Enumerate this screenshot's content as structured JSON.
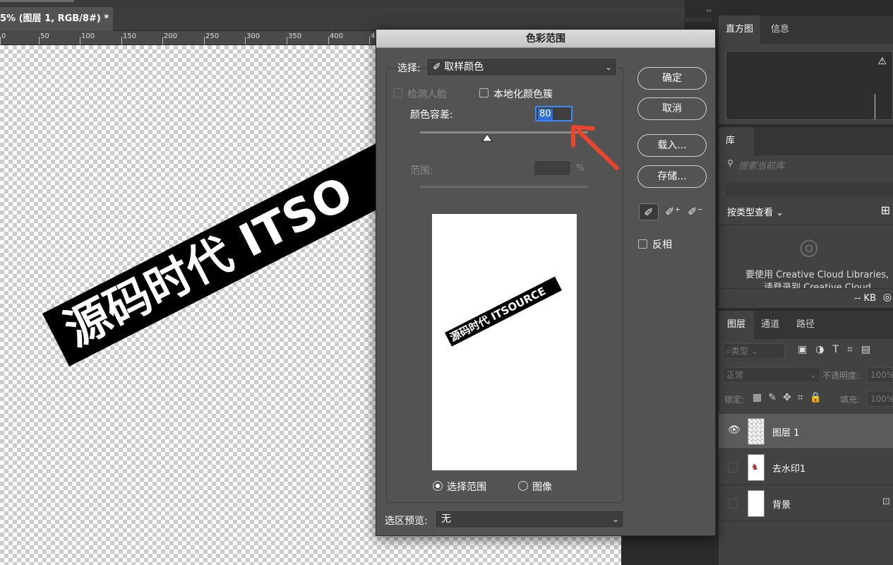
{
  "document": {
    "tab_title": "5% (图层 1, RGB/8#) *",
    "ruler_marks": [
      "0",
      "50",
      "100",
      "150",
      "200",
      "250",
      "300",
      "350",
      "400",
      "4"
    ],
    "canvas_text": "源码时代 ITSO"
  },
  "dialog": {
    "title": "色彩范围",
    "select_label": "选择:",
    "select_value": "取样颜色",
    "detect_faces_label": "检测人脸",
    "localized_clusters_label": "本地化颜色簇",
    "fuzziness_label": "颜色容差:",
    "fuzziness_value": "80",
    "fuzziness_level": 0.4,
    "range_label": "范围:",
    "range_unit": "%",
    "preview_text": "源码时代 ITSOURCE",
    "radio_selection_label": "选择范围",
    "radio_image_label": "图像",
    "selection_preview_label": "选区预览:",
    "selection_preview_value": "无",
    "buttons": {
      "ok": "确定",
      "cancel": "取消",
      "load": "载入...",
      "save": "存储..."
    },
    "invert_label": "反相"
  },
  "panels": {
    "histogram_tab": "直方图",
    "info_tab": "信息",
    "library_tab": "库",
    "library_search_placeholder": "搜索当前库",
    "view_by_type": "按类型查看",
    "cc_message_line1": "要使用 Creative Cloud Libraries,",
    "cc_message_line2": "请登录到 Creative Cloud",
    "kb_label": "-- KB",
    "layers_tab": "图层",
    "channels_tab": "通道",
    "paths_tab": "路径",
    "filter_kind": "类型",
    "blend_mode": "正常",
    "opacity_label": "不透明度:",
    "opacity_value": "100%",
    "lock_label": "锁定:",
    "fill_label": "填充:",
    "fill_value": "100%",
    "layers": [
      {
        "name": "图层 1"
      },
      {
        "name": "去水印1"
      },
      {
        "name": "背景"
      }
    ]
  },
  "colors": {
    "accent": "#3d8af7",
    "annotation_arrow": "#e8452c"
  }
}
